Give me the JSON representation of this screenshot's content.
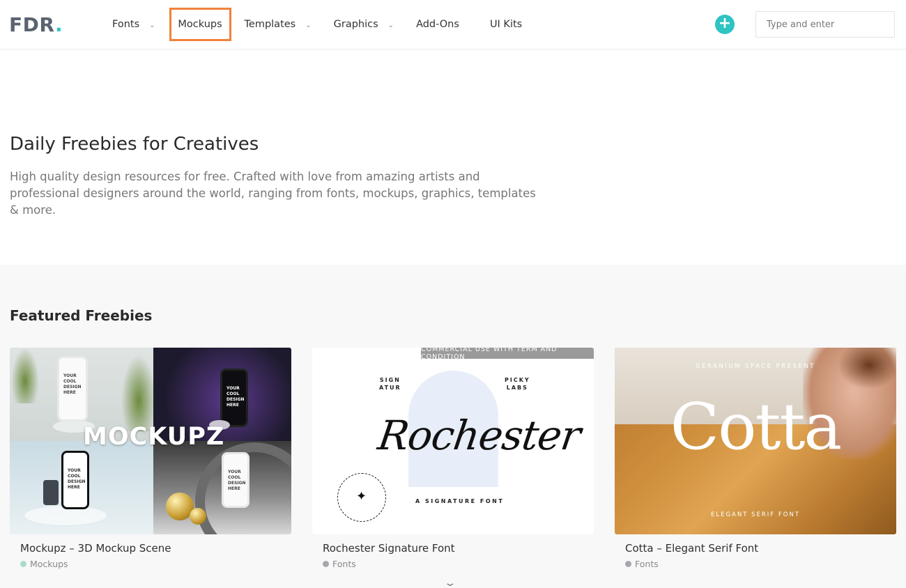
{
  "header": {
    "logo_text": "FDR",
    "logo_dot": ".",
    "nav": [
      {
        "label": "Fonts",
        "has_dropdown": true
      },
      {
        "label": "Mockups",
        "has_dropdown": false,
        "highlighted": true
      },
      {
        "label": "Templates",
        "has_dropdown": true
      },
      {
        "label": "Graphics",
        "has_dropdown": true
      },
      {
        "label": "Add-Ons",
        "has_dropdown": false
      },
      {
        "label": "UI Kits",
        "has_dropdown": false
      }
    ],
    "dropdown_glyph": "⌄",
    "add_button_icon": "plus-icon",
    "add_button_glyph": "+",
    "search": {
      "placeholder": "Type and enter",
      "value": ""
    }
  },
  "hero": {
    "title": "Daily Freebies for Creatives",
    "description": "High quality design resources for free. Crafted with love from amazing artists and professional designers around the world, ranging from fonts, mockups, graphics, templates & more."
  },
  "featured": {
    "title": "Featured Freebies",
    "cards": [
      {
        "title": "Mockupz – 3D Mockup Scene",
        "category": "Mockups",
        "category_color": "#a8dcc8",
        "image": {
          "headline": "MOCKUPZ",
          "phone_text": "YOUR COOL DESIGN HERE"
        }
      },
      {
        "title": "Rochester Signature Font",
        "category": "Fonts",
        "category_color": "#a6a6ad",
        "image": {
          "banner": "COMMERCIAL USE WITH TERM AND CONDITION",
          "left_small": "SIGN\nATUR",
          "right_small": "PICKY\nLABS",
          "script": "Rochester",
          "tagline": "A SIGNATURE FONT",
          "badge_icon": "sparkle-icon"
        }
      },
      {
        "title": "Cotta – Elegant Serif Font",
        "category": "Fonts",
        "category_color": "#a6a6ad",
        "image": {
          "pretitle": "GERANIUM SPACE PRESENT",
          "word": "Cotta",
          "subtitle": "ELEGANT SERIF FONT"
        }
      }
    ]
  },
  "scroll_indicator": "chevron-down-icon",
  "colors": {
    "accent": "#2ec4c4",
    "highlight_outline": "#f2813a",
    "featured_bg": "#f8f8f8"
  }
}
